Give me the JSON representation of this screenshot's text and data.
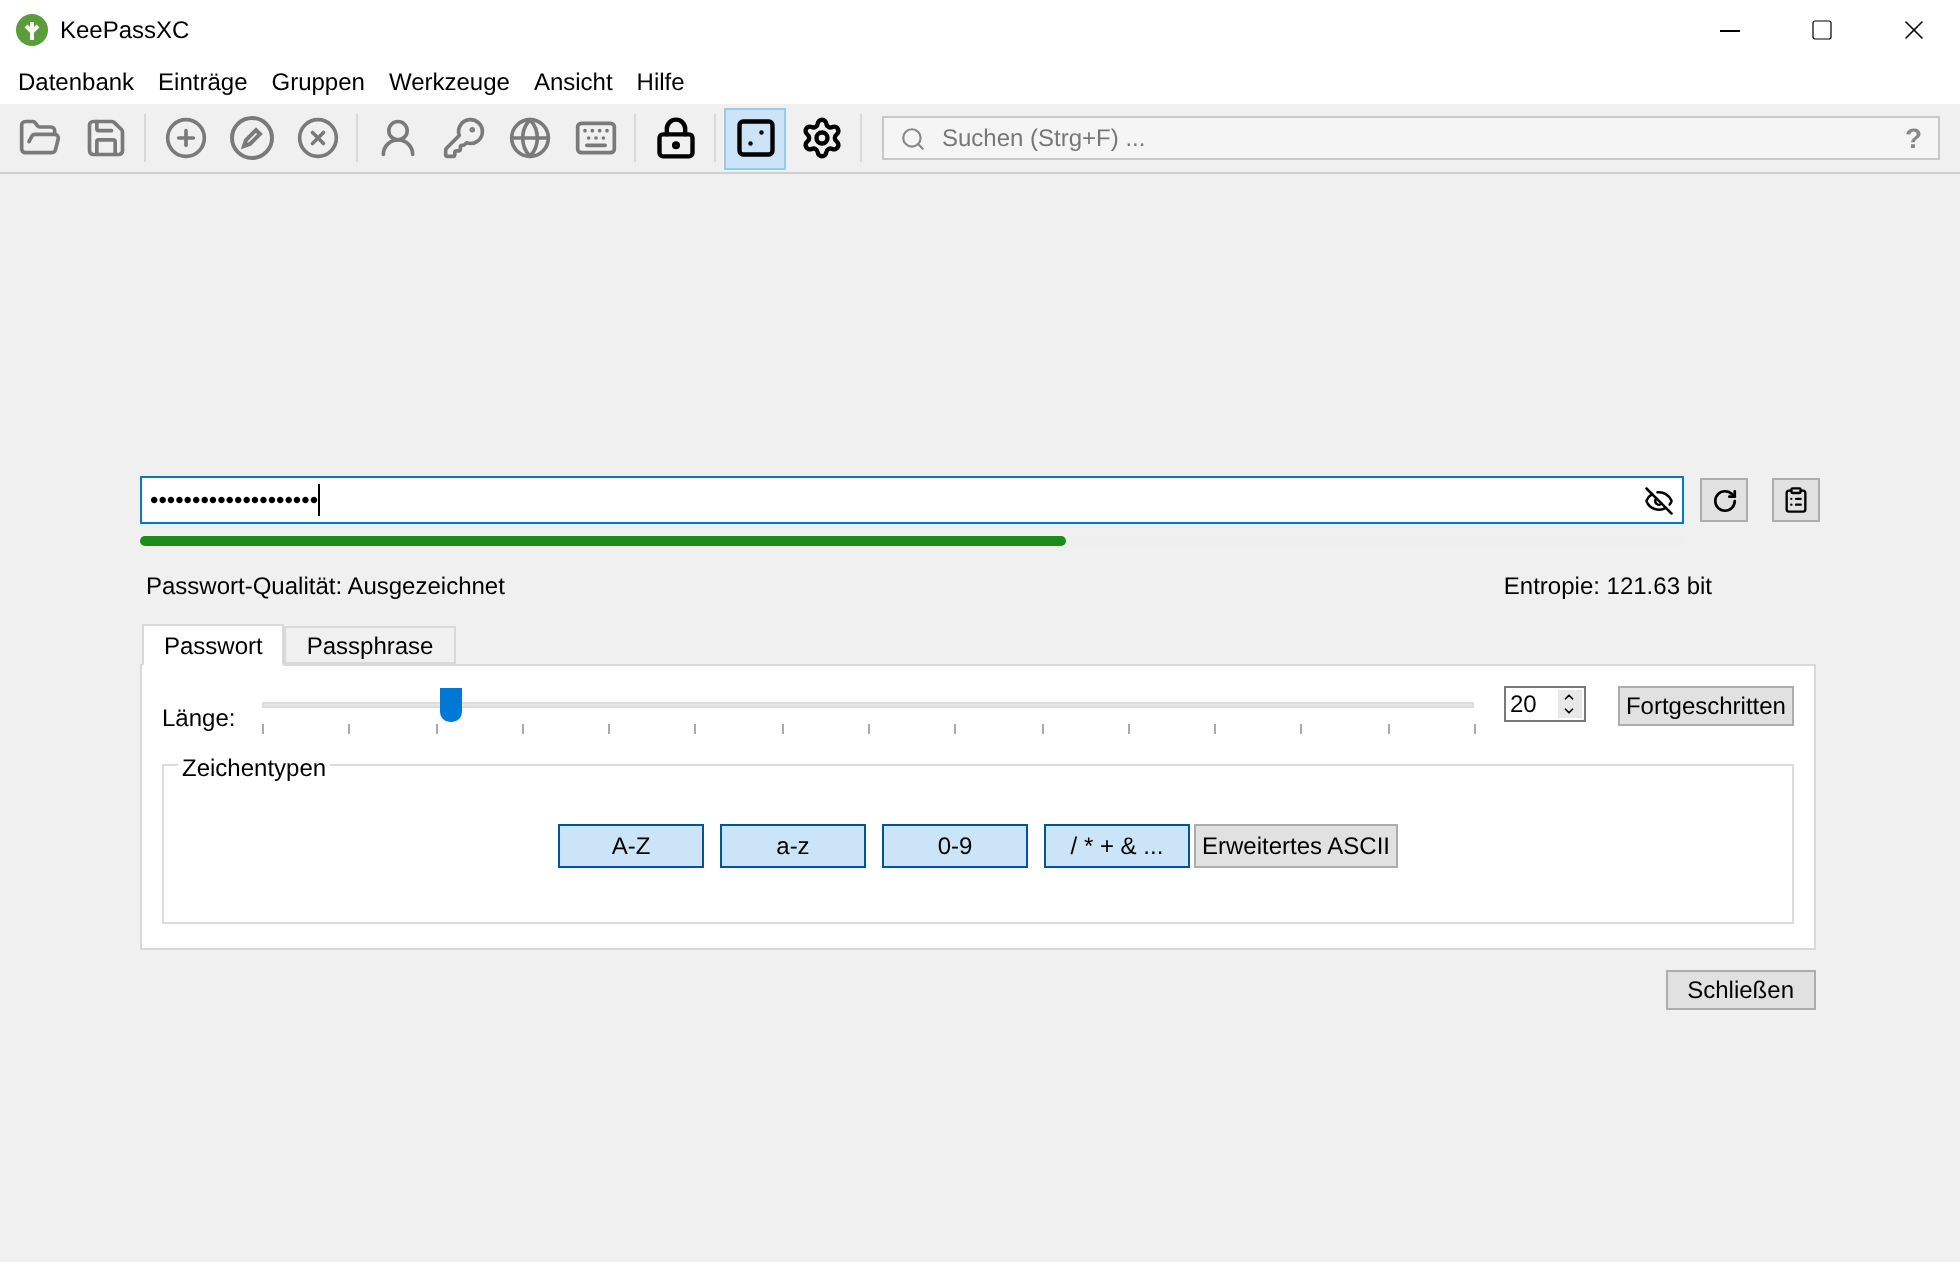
{
  "window": {
    "title": "KeePassXC"
  },
  "menu": [
    "Datenbank",
    "Einträge",
    "Gruppen",
    "Werkzeuge",
    "Ansicht",
    "Hilfe"
  ],
  "toolbar": [
    {
      "disabled": true,
      "selected": false
    },
    {
      "disabled": true,
      "selected": false
    },
    {
      "disabled": true,
      "selected": false
    },
    {
      "disabled": true,
      "selected": false
    },
    {
      "disabled": true,
      "selected": false
    },
    {
      "disabled": true,
      "selected": false
    },
    {
      "disabled": true,
      "selected": false
    },
    {
      "disabled": true,
      "selected": false
    },
    {
      "disabled": true,
      "selected": false
    },
    {
      "disabled": false,
      "selected": false
    },
    {
      "disabled": false,
      "selected": true
    },
    {
      "disabled": false,
      "selected": false
    }
  ],
  "search": {
    "placeholder": "Suchen (Strg+F) ...",
    "help": "?"
  },
  "password": {
    "value": "••••••••••••••••••••",
    "strength": {
      "level": 0.6
    },
    "quality": "Passwort-Qualität: Ausgezeichnet",
    "entropy": "Entropie: 121.63 bit"
  },
  "tabs": [
    {
      "label": "Passwort",
      "selected": true
    },
    {
      "label": "Passphrase",
      "selected": false
    }
  ],
  "length": {
    "label": "Länge:",
    "level": 0.155,
    "value": "20"
  },
  "advanced_button": "Fortgeschritten",
  "char_types": {
    "title": "Zeichentypen",
    "buttons": [
      {
        "label": "A-Z",
        "selected": true
      },
      {
        "label": "a-z",
        "selected": true
      },
      {
        "label": "0-9",
        "selected": true
      },
      {
        "label": "/ * + & ...",
        "selected": true
      },
      {
        "label": "Erweitertes ASCII",
        "selected": false
      }
    ]
  },
  "close_button": "Schließen"
}
